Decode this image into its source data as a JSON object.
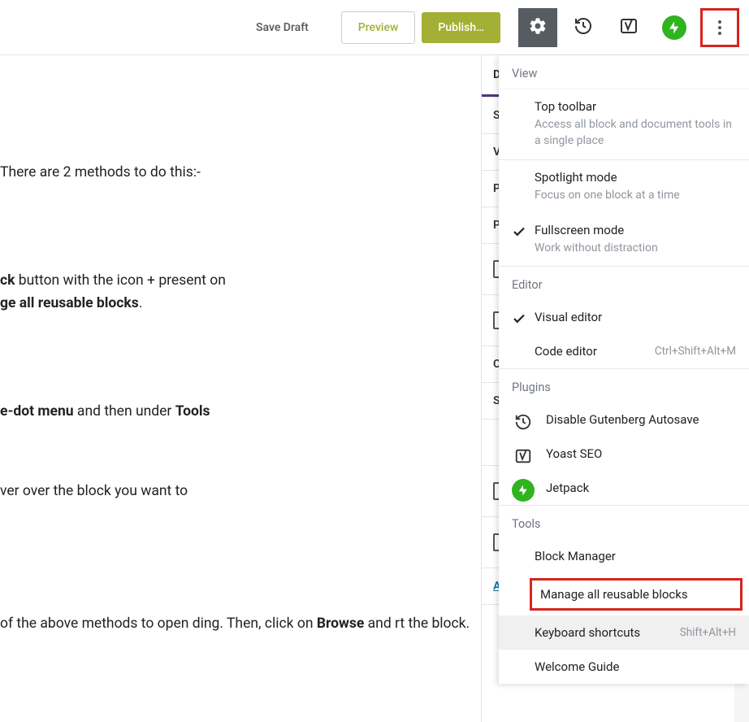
{
  "toolbar": {
    "save_draft": "Save Draft",
    "preview": "Preview",
    "publish": "Publish…"
  },
  "content": {
    "p1": "There are 2 methods to do this:-",
    "p2_a": "ck",
    "p2_b": " button with the icon + present on ",
    "p2_c": "ge all reusable blocks",
    "p2_d": ".",
    "p3_a": "e-dot menu",
    "p3_b": " and then under ",
    "p3_c": "Tools",
    "p4": "ver over the block you want to",
    "p5_a": "of the above methods to open ding. Then, click on ",
    "p5_b": "Browse",
    "p5_c": " and rt the block."
  },
  "sidebar": {
    "tab_d": "D",
    "row_s": "S",
    "row_v": "V",
    "row_p1": "P",
    "row_p2": "P",
    "row_c": "C",
    "row_s2": "S",
    "row_a": "A"
  },
  "dropdown": {
    "section_view": "View",
    "top_toolbar": {
      "title": "Top toolbar",
      "sub": "Access all block and document tools in a single place"
    },
    "spotlight": {
      "title": "Spotlight mode",
      "sub": "Focus on one block at a time"
    },
    "fullscreen": {
      "title": "Fullscreen mode",
      "sub": "Work without distraction"
    },
    "section_editor": "Editor",
    "visual_editor": "Visual editor",
    "code_editor": {
      "title": "Code editor",
      "shortcut": "Ctrl+Shift+Alt+M"
    },
    "section_plugins": "Plugins",
    "disable_autosave": "Disable Gutenberg Autosave",
    "yoast": "Yoast SEO",
    "jetpack": "Jetpack",
    "section_tools": "Tools",
    "block_manager": "Block Manager",
    "manage_reusable": "Manage all reusable blocks",
    "keyboard_shortcuts": {
      "title": "Keyboard shortcuts",
      "shortcut": "Shift+Alt+H"
    },
    "welcome_guide": "Welcome Guide"
  }
}
